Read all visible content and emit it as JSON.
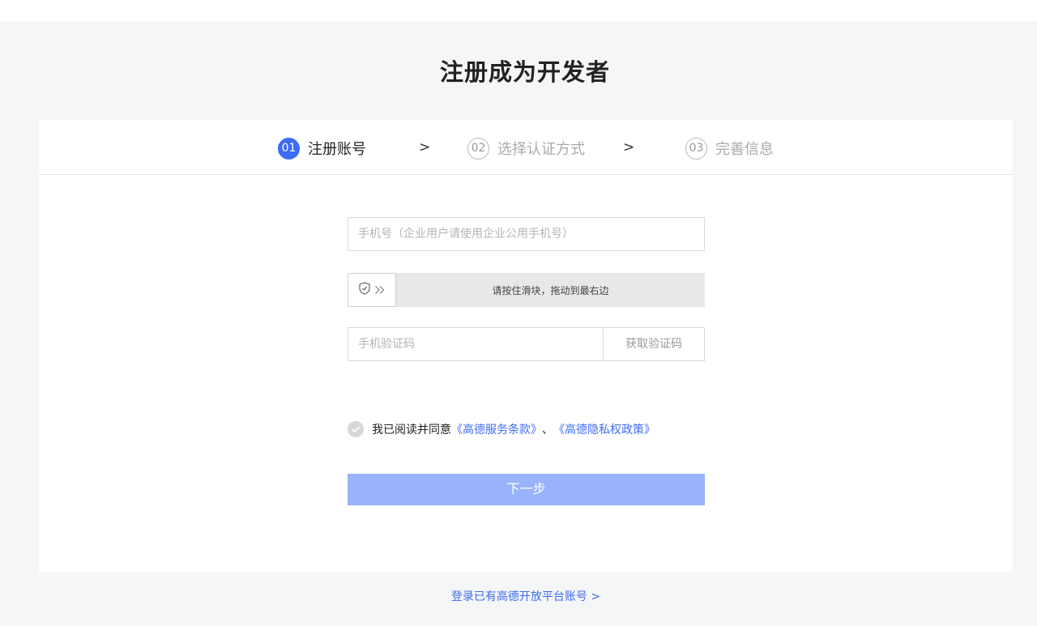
{
  "page": {
    "title": "注册成为开发者"
  },
  "steps": [
    {
      "num": "01",
      "label": "注册账号",
      "active": true
    },
    {
      "num": "02",
      "label": "选择认证方式",
      "active": false
    },
    {
      "num": "03",
      "label": "完善信息",
      "active": false
    }
  ],
  "step_separator": ">",
  "form": {
    "phone_placeholder": "手机号（企业用户请使用企业公用手机号）",
    "slider_text": "请按住滑块，拖动到最右边",
    "code_placeholder": "手机验证码",
    "get_code_label": "获取验证码",
    "agree_text": "我已阅读并同意",
    "terms_link": "《高德服务条款》",
    "agree_separator": "、",
    "privacy_link": "《高德隐私权政策》",
    "next_label": "下一步"
  },
  "footer": {
    "login_link": "登录已有高德开放平台账号 >"
  },
  "colors": {
    "accent": "#3d6cf5",
    "button_disabled": "#98b3fa",
    "background": "#f5f6f8"
  },
  "icons": {
    "slider_shield": "shield-check-icon",
    "slider_arrows": "double-chevron-right-icon",
    "agree_check": "check-icon"
  }
}
